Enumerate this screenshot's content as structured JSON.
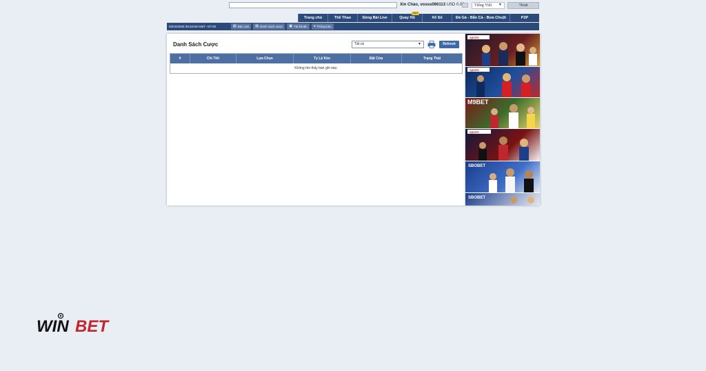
{
  "header": {
    "greeting": "Xin Chào, vosss066113",
    "balance": "USD 0.00",
    "language": "Tiếng Việt",
    "logout_label": "Thoát"
  },
  "nav": {
    "items": [
      {
        "label": "Trang chủ"
      },
      {
        "label": "Thể Thao"
      },
      {
        "label": "Sòng Bài Live"
      },
      {
        "label": "Quay Hũ",
        "badge": "HOT"
      },
      {
        "label": "Xổ Số"
      },
      {
        "label": "Đá Gà - Bắn Cá - Bưa Chuột"
      },
      {
        "label": "P2P"
      }
    ]
  },
  "subbar": {
    "datetime": "03/10/2025 08:32AM GMT +07:00",
    "buttons": [
      {
        "label": "Báo cáo",
        "icon": "report-icon"
      },
      {
        "label": "Danh sách cược",
        "icon": "list-icon"
      },
      {
        "label": "Tài khoản",
        "icon": "account-icon"
      },
      {
        "label": "Thông báo",
        "icon": "megaphone-icon"
      }
    ]
  },
  "panel": {
    "title": "Danh Sách Cược",
    "filter_value": "Tất cả",
    "refresh_label": "Refresh",
    "columns": [
      "#",
      "Chi Tiết",
      "Lựa Chọn",
      "Tỷ Lệ Kèo",
      "Đặt Cửa",
      "Trạng Thái"
    ],
    "empty_message": "Không tìm thấy bản ghi nào."
  },
  "banners": [
    {
      "brand": "sports"
    },
    {
      "brand": "sports"
    },
    {
      "brand": "M9BET"
    },
    {
      "brand": "sports"
    },
    {
      "brand": "SBOBET"
    },
    {
      "brand": "SBOBET"
    }
  ],
  "brand": {
    "logo_text_a": "WIN",
    "logo_text_b": "BET",
    "colors": {
      "nav": "#2b4a7a",
      "accent": "#c0262d",
      "header_table": "#4e6fa1"
    }
  }
}
